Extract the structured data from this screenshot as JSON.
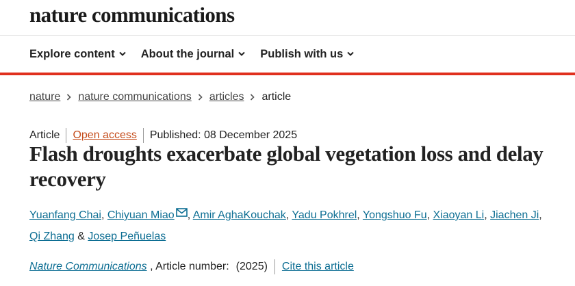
{
  "header": {
    "logo_text": "nature communications"
  },
  "nav": {
    "items": [
      {
        "label": "Explore content"
      },
      {
        "label": "About the journal"
      },
      {
        "label": "Publish with us"
      }
    ]
  },
  "breadcrumb": {
    "items": [
      {
        "label": "nature"
      },
      {
        "label": "nature communications"
      },
      {
        "label": "articles"
      }
    ],
    "current": "article"
  },
  "article": {
    "type": "Article",
    "access": "Open access",
    "published": "Published: 08 December 2025",
    "title": "Flash droughts exacerbate global vegetation loss and delay recovery",
    "authors": [
      "Yuanfang Chai",
      "Chiyuan Miao",
      "Amir AghaKouchak",
      "Yadu Pokhrel",
      "Yongshuo Fu",
      "Xiaoyan Li",
      "Jiachen Ji",
      "Qi Zhang",
      "Josep Peñuelas"
    ],
    "separators": {
      "comma": ", ",
      "amp": " & "
    },
    "journal": "Nature Communications",
    "article_number_label": " , Article number:",
    "year": "(2025)",
    "cite_label": "Cite this article"
  },
  "colors": {
    "accent_red": "#e0301e",
    "link_blue": "#0d6e93",
    "open_access_orange": "#c54d1c",
    "text": "#222222"
  },
  "icons": {
    "nav_chevron": "chevron-down-icon",
    "breadcrumb_separator": "chevron-right-icon",
    "corresponding_author": "mail-icon"
  }
}
